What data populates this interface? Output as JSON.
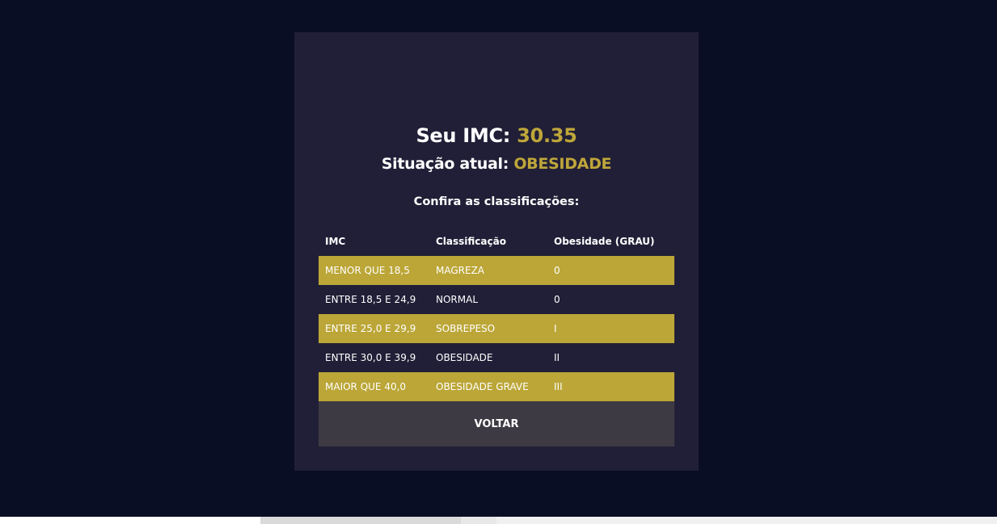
{
  "result": {
    "imc_label": "Seu IMC:",
    "imc_value": "30.35",
    "status_label": "Situação atual:",
    "status_value": "OBESIDADE",
    "table_heading": "Confira as classificações:"
  },
  "table": {
    "headers": [
      "IMC",
      "Classificação",
      "Obesidade (GRAU)"
    ],
    "rows": [
      [
        "MENOR QUE 18,5",
        "MAGREZA",
        "0"
      ],
      [
        "ENTRE 18,5 E 24,9",
        "NORMAL",
        "0"
      ],
      [
        "ENTRE 25,0 E 29,9",
        "SOBREPESO",
        "I"
      ],
      [
        "ENTRE 30,0 E 39,9",
        "OBESIDADE",
        "II"
      ],
      [
        "MAIOR QUE 40,0",
        "OBESIDADE GRAVE",
        "III"
      ]
    ]
  },
  "actions": {
    "back_label": "VOLTAR"
  },
  "colors": {
    "background": "#090e24",
    "card": "#211f37",
    "accent": "#bea63a",
    "stripe": "#bba637",
    "button": "#3d3a43"
  }
}
